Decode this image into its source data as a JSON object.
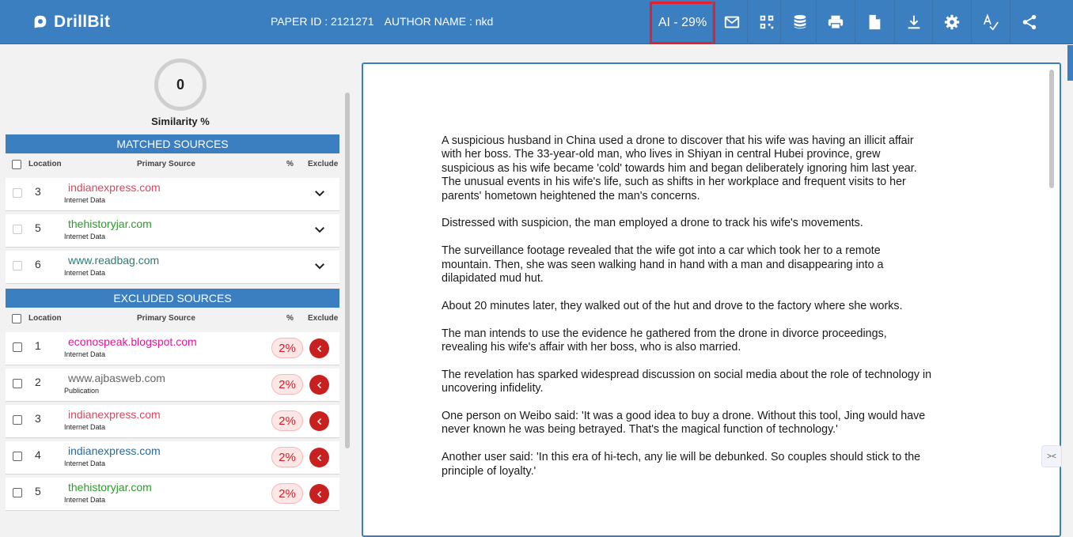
{
  "header": {
    "brand": "DrillBit",
    "paper_id": "PAPER ID : 2121271",
    "author_name": "AUTHOR NAME : nkd",
    "ai_score": "AI - 29%",
    "icons": [
      "mail-icon",
      "qr-code-icon",
      "database-icon",
      "print-icon",
      "document-icon",
      "download-icon",
      "settings-icon",
      "spellcheck-icon",
      "share-icon"
    ],
    "accent_color": "#3c7fc0",
    "highlight_color": "#e4202e"
  },
  "similarity": {
    "value": "0",
    "label": "Similarity %"
  },
  "columns": {
    "location": "Location",
    "primary_source": "Primary Source",
    "percent": "%",
    "exclude": "Exclude"
  },
  "matched": {
    "title": "MATCHED SOURCES",
    "rows": [
      {
        "loc": "3",
        "source": "indianexpress.com",
        "type": "Internet Data",
        "color": "#d9475e"
      },
      {
        "loc": "5",
        "source": "thehistoryjar.com",
        "type": "Internet Data",
        "color": "#2e9a2e"
      },
      {
        "loc": "6",
        "source": "www.readbag.com",
        "type": "Internet Data",
        "color": "#2a7a7a"
      }
    ]
  },
  "excluded": {
    "title": "EXCLUDED SOURCES",
    "rows": [
      {
        "loc": "1",
        "source": "econospeak.blogspot.com",
        "type": "Internet Data",
        "pct": "2%",
        "color": "#e0179b"
      },
      {
        "loc": "2",
        "source": "www.ajbasweb.com",
        "type": "Publication",
        "pct": "2%",
        "color": "#666666"
      },
      {
        "loc": "3",
        "source": "indianexpress.com",
        "type": "Internet Data",
        "pct": "2%",
        "color": "#d9475e"
      },
      {
        "loc": "4",
        "source": "indianexpress.com",
        "type": "Internet Data",
        "pct": "2%",
        "color": "#2a6a9a"
      },
      {
        "loc": "5",
        "source": "thehistoryjar.com",
        "type": "Internet Data",
        "pct": "2%",
        "color": "#2e9a2e"
      }
    ]
  },
  "document": {
    "paragraphs": [
      "A suspicious husband in China used a drone to discover that his wife was having an illicit affair with her boss. The 33-year-old man, who lives in Shiyan in central Hubei province, grew suspicious as his wife became 'cold' towards him and began deliberately ignoring him last year.",
      "The unusual events in his wife's life, such as shifts in her workplace and frequent visits to her parents' hometown heightened the man's concerns.",
      "Distressed with suspicion, the man employed a drone to track his wife's movements.",
      "The surveillance footage revealed that the wife got into a car which took her to a remote mountain. Then, she was seen walking hand in hand with a man and disappearing into a dilapidated mud hut.",
      "About 20 minutes later, they walked out of the hut and drove to the factory where she works.",
      "The man intends to use the evidence he gathered from the drone in divorce proceedings, revealing his wife's affair with her boss, who is also married.",
      "The revelation has sparked widespread discussion on social media about the role of technology in uncovering infidelity.",
      "One person on Weibo said: 'It was a good idea to buy a drone. Without this tool, Jing would have never known he was being betrayed. That's the magical function of technology.'",
      "Another user said: 'In this era of hi-tech, any lie will be debunked. So couples should stick to the principle of loyalty.'"
    ]
  }
}
